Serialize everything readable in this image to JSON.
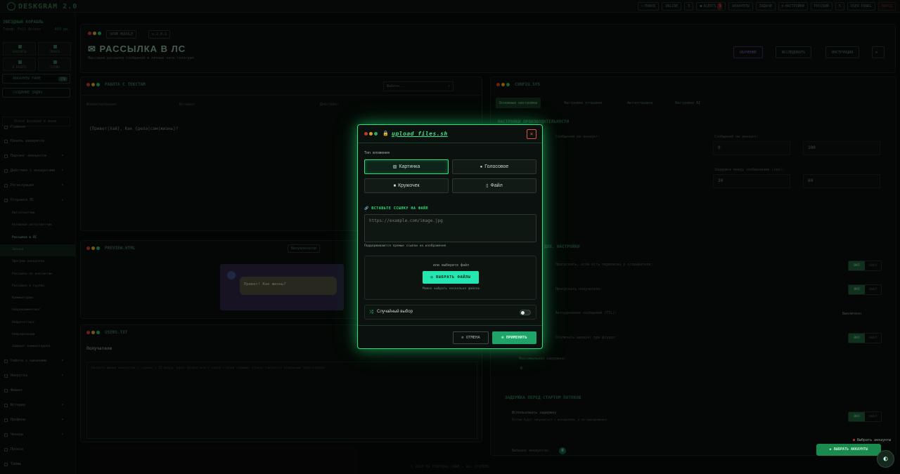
{
  "app": {
    "logo": "DESKGRAM 2.0"
  },
  "topbar": {
    "items": [
      "ПОИСК",
      "ONLINE",
      "5",
      "ALERTS",
      "АККАУНТЫ",
      "ЗАДАЧИ",
      "НАСТРОЙКИ",
      "РУССКИЙ",
      "5",
      "USER PANEL",
      "ВЫХОД"
    ],
    "alerts_badge": "9"
  },
  "sidebar": {
    "title": "ЗВЕЗДНЫЙ КОРАБЛЬ",
    "subtitle": "Тариф: Full Access",
    "balance": "493 дн.",
    "stats": [
      "АККАУНТЫ",
      "ПРОКСИ",
      "В РАБОТЕ",
      "ГОТОВО"
    ],
    "field1": "АККАУНТЫ FARM",
    "field1_badge": "178",
    "field2": "СОЗДАНИЕ ЗАДАЧ",
    "search_placeholder": "Поиск функций в меню",
    "nav": [
      "Главная",
      "Панель аккаунтов",
      "Парсинг аккаунтов",
      "Действия с аккаунтами",
      "Регистрация",
      "Отправка ЛС",
      "Автоответчик",
      "Активный автоответчик",
      "Рассылка в ЛС",
      "Звонки",
      "Прогрев аккаунтов",
      "Рассылка по контактам",
      "Рассылка в группы",
      "Комментарии",
      "Нейрокомментинг",
      "Нейрочаттинг",
      "Нейрореакции",
      "Зайвинг комментариев",
      "Работа с каналами",
      "Накрутка",
      "Фишинг",
      "История",
      "Профили",
      "Чекеры",
      "Прокси",
      "Таймы"
    ]
  },
  "header": {
    "badge1": "SPAM MODULE",
    "badge2": "v.2.0.1",
    "title": "РАССЫЛКА В ЛС",
    "subtitle": "Массовая рассылка сообщений в личные чаты телеграм",
    "btn1": "ОБУЧЕНИЕ",
    "btn2": "ИССЛЕДОВАТЬ",
    "btn3": "ИНСТРУКЦИЯ"
  },
  "panels": {
    "text": {
      "title": "РАБОТА С ТЕКСТОМ",
      "select": "Шаблон...",
      "toolbar_labels": [
        "Форматирование:",
        "Вставки:",
        "Действия:"
      ],
      "content": "{Привет|Хай}, Как {дела|сам|жизнь}?"
    },
    "preview": {
      "title": "PREVIEW.HTML",
      "badge": "Визуализатор",
      "message": "Привет! Как жизнь?"
    },
    "recipients": {
      "title": "USERS.TXT",
      "label": "Получатели",
      "placeholder": "Введите имена аккаунтов / ссылки / ID юзера через пробел или с новой строки (каждая строка считается отдельным получателем)"
    },
    "config": {
      "title": "CONFIG.SYS",
      "tabs": [
        "Основные настройки",
        "Настройки отправки",
        "Автоотправка",
        "Настройки AI"
      ],
      "sec1": "НАСТРОЙКИ ПРОИЗВОДИТЕЛЬНОСТИ",
      "r1": "Сообщений на аккаунт:",
      "r2": "Задержка между сообщениями:",
      "r3": "Задержка между сообщениями (сек):",
      "v1a": "0",
      "v1b": "100",
      "v2a": "30",
      "v2b": "60",
      "sec2": "ДОП. НАСТРОЙКИ",
      "l1": "Пропускать, если есть переписка у отправителя:",
      "l2": "Пропускать получателя:",
      "l3": "Автоудаление сообщений (TTL):",
      "l3v": "Выключено",
      "l4": "Отключать аккаунт при флудах:",
      "l5": "Максимальная задержка:",
      "l5v": "0",
      "sec3": "ЗАДЕРЖКА ПЕРЕД СТАРТОМ ПОТОКОВ",
      "l6": "Использовать задержку",
      "l6s": "Потоки будут запускаться с интервалом, а не одновременно",
      "on": "ВКЛ",
      "off": "ВЫКЛ",
      "accounts_label": "Выбрано аккаунтов:",
      "accounts_value": "0",
      "launch": "ВЫБРАТЬ АККАУНТЫ",
      "select_accounts": "Выбрать аккаунты"
    }
  },
  "modal": {
    "title": "upload_files.sh",
    "type_label": "Тип вложения",
    "options": [
      {
        "label": "Картинка",
        "icon": "image-icon",
        "selected": true
      },
      {
        "label": "Голосовое",
        "icon": "microphone-icon",
        "selected": false
      },
      {
        "label": "Кружочек",
        "icon": "video-icon",
        "selected": false
      },
      {
        "label": "Файл",
        "icon": "file-icon",
        "selected": false
      }
    ],
    "link_label": "ВСТАВЬТЕ ССЫЛКУ НА ФАЙЛ",
    "url_placeholder": "https://example.com/image.jpg",
    "hint": "Поддерживаются прямые ссылки на изображения",
    "or_text": "или выберите файл",
    "pick_button": "ВЫБРАТЬ ФАЙЛЫ",
    "multi_hint": "Можно выбрать несколько файлов",
    "random_label": "Случайный выбор",
    "cancel": "ОТМЕНА",
    "apply": "ПРИМЕНИТЬ"
  },
  "footer": "© 2025 DG TERMINAL CORE — ALL SYSTEMS"
}
